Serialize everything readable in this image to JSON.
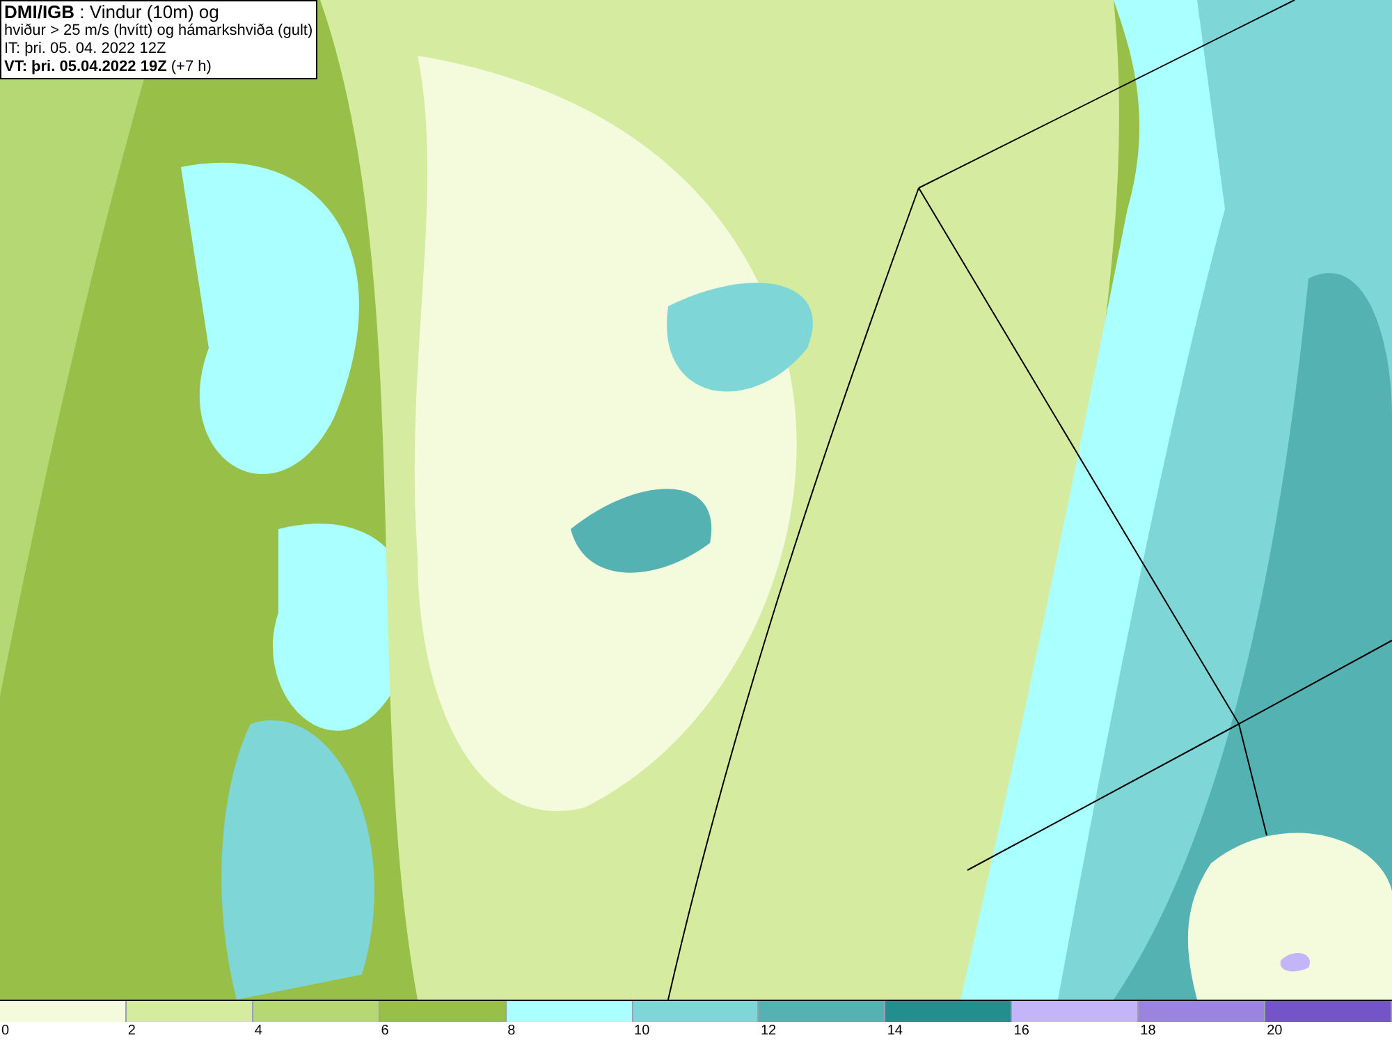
{
  "title_box": {
    "lines": [
      "**DMI/IGB** : Vindur (10m) og",
      "hviður > 25 m/s (hvítt) og hámarkshviða (gult)",
      "IT: þri. 05. 04. 2022 12Z",
      "**VT: þri. 05.04.2022 19Z** (+7 h)"
    ]
  },
  "legend": [
    {
      "label": "0",
      "color": "#f4fadc"
    },
    {
      "label": "2",
      "color": "#d4eba0"
    },
    {
      "label": "4",
      "color": "#b6d874"
    },
    {
      "label": "6",
      "color": "#98bf48"
    },
    {
      "label": "8",
      "color": "#aaffff"
    },
    {
      "label": "10",
      "color": "#7fd6d6"
    },
    {
      "label": "12",
      "color": "#55b2b2"
    },
    {
      "label": "14",
      "color": "#228e8e"
    },
    {
      "label": "16",
      "color": "#c4b4f8"
    },
    {
      "label": "18",
      "color": "#9a84e0"
    },
    {
      "label": "20",
      "color": "#7355c8"
    }
  ]
}
